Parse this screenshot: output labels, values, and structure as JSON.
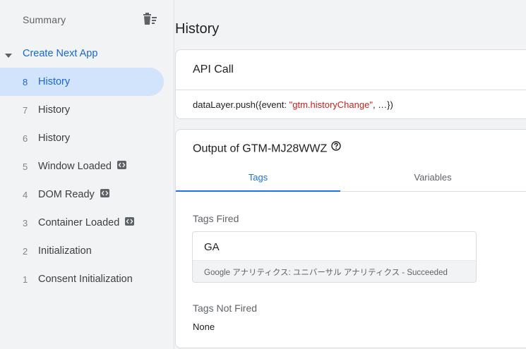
{
  "sidebar": {
    "summary_label": "Summary",
    "app_label": "Create Next App",
    "events": [
      {
        "num": "8",
        "name": "History",
        "selected": true,
        "code": false
      },
      {
        "num": "7",
        "name": "History",
        "selected": false,
        "code": false
      },
      {
        "num": "6",
        "name": "History",
        "selected": false,
        "code": false
      },
      {
        "num": "5",
        "name": "Window Loaded",
        "selected": false,
        "code": true
      },
      {
        "num": "4",
        "name": "DOM Ready",
        "selected": false,
        "code": true
      },
      {
        "num": "3",
        "name": "Container Loaded",
        "selected": false,
        "code": true
      },
      {
        "num": "2",
        "name": "Initialization",
        "selected": false,
        "code": false
      },
      {
        "num": "1",
        "name": "Consent Initialization",
        "selected": false,
        "code": false
      }
    ]
  },
  "main": {
    "page_title": "History",
    "api_card": {
      "title": "API Call",
      "code_prefix": "dataLayer.push({event: ",
      "code_string": "\"gtm.historyChange\"",
      "code_suffix": ", …})"
    },
    "output_card": {
      "title": "Output of GTM-MJ28WWZ",
      "tabs": {
        "tags": "Tags",
        "variables": "Variables"
      },
      "tags_fired_label": "Tags Fired",
      "fired_tag": {
        "name": "GA",
        "status": "Google アナリティクス: ユニバーサル アナリティクス - Succeeded"
      },
      "tags_not_fired_label": "Tags Not Fired",
      "not_fired_value": "None"
    }
  },
  "colors": {
    "accent": "#1a73e8",
    "selected_bg": "#d2e3fc",
    "code_string": "#c5221f"
  }
}
